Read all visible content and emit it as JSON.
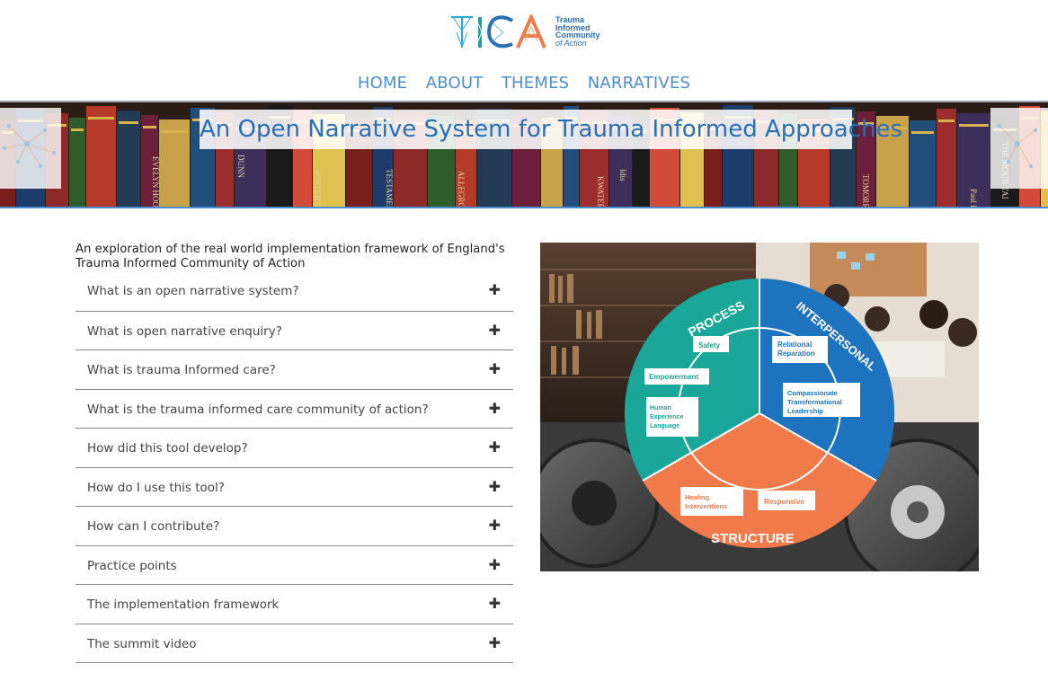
{
  "logo": {
    "mark": "TICA",
    "lines": [
      "Trauma",
      "Informed",
      "Community",
      "of Action"
    ]
  },
  "nav": {
    "items": [
      "HOME",
      "ABOUT",
      "THEMES",
      "NARRATIVES"
    ]
  },
  "banner": {
    "title": "An Open Narrative System for Trauma Informed Approaches",
    "book_spines": [
      "EVELYN HOOD",
      "DUNN",
      "WINTER'S END",
      "TESTAMENT",
      "ALLEGRO",
      "KWATER",
      "Idis",
      "TOMORROW'S TREASON",
      "Paul Horgan",
      "THE MOUN TAI"
    ]
  },
  "intro": {
    "text": "An exploration of the real world implementation framework of England's Trauma Informed Community of Action"
  },
  "accordion": {
    "items": [
      {
        "label": "What is an open narrative system?"
      },
      {
        "label": "What is open narrative enquiry?"
      },
      {
        "label": "What is trauma Informed care?"
      },
      {
        "label": "What is the trauma informed care community of action?"
      },
      {
        "label": "How did this tool develop?"
      },
      {
        "label": "How do I use this tool?"
      },
      {
        "label": "How can I contribute?"
      },
      {
        "label": "Practice points"
      },
      {
        "label": "The implementation framework"
      },
      {
        "label": "The summit video"
      }
    ],
    "expand_icon": "plus-icon"
  },
  "framework": {
    "segments": [
      "PROCESS",
      "INTERPERSONAL",
      "STRUCTURE"
    ],
    "labels": [
      "Safety",
      "Relational Reparation",
      "Empowerment",
      "Compassionate Transformational Leadership",
      "Human Experience Language",
      "Healing Interventions",
      "Responsive"
    ],
    "colors": {
      "process": "#1aa79a",
      "interpersonal": "#1e73be",
      "structure": "#f07a4a"
    }
  },
  "colors": {
    "accent": "#4a8fd1",
    "title": "#2a6fb3"
  }
}
